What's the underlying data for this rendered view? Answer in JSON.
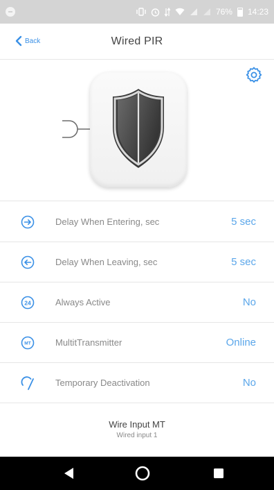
{
  "status_bar": {
    "battery": "76%",
    "time": "14:23"
  },
  "header": {
    "back_label": "Back",
    "title": "Wired PIR"
  },
  "colors": {
    "accent": "#3a90e6",
    "value": "#5aa6ea",
    "status_bar_bg": "#d4d4d4",
    "nav_bar_bg": "#000000"
  },
  "device": {
    "icon": "shield-icon",
    "connector_icon": "wire-connector-icon",
    "settings_icon": "gear-icon"
  },
  "settings": [
    {
      "icon": "arrow-right-circle-icon",
      "label": "Delay When Entering, sec",
      "value": "5 sec"
    },
    {
      "icon": "arrow-left-circle-icon",
      "label": "Delay When Leaving, sec",
      "value": "5 sec"
    },
    {
      "icon": "24-hour-icon",
      "label": "Always Active",
      "value": "No"
    },
    {
      "icon": "mt-icon",
      "label": "MultitTransmitter",
      "value": "Online"
    },
    {
      "icon": "temporary-deactivation-icon",
      "label": "Temporary Deactivation",
      "value": "No"
    }
  ],
  "info": {
    "title": "Wire Input MT",
    "subtitle": "Wired input 1"
  },
  "nav": {
    "back_icon": "nav-back-icon",
    "home_icon": "nav-home-icon",
    "recents_icon": "nav-recents-icon"
  }
}
